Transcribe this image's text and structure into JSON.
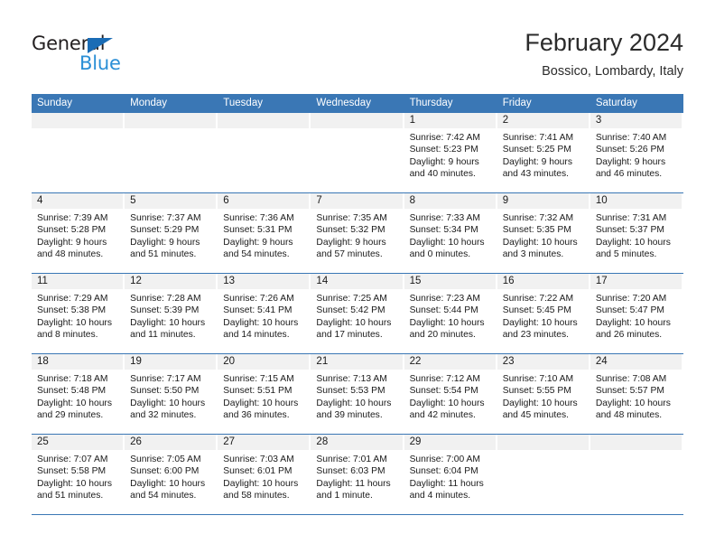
{
  "brand": {
    "name_part1": "General",
    "name_part2": "Blue",
    "accent_color": "#2b8fd6",
    "triangle_color": "#1a6cb5"
  },
  "header": {
    "title": "February 2024",
    "subtitle": "Bossico, Lombardy, Italy"
  },
  "theme": {
    "header_band": "#3a77b5",
    "day_band": "#f1f1f1",
    "text": "#1a1a1a"
  },
  "weekdays": [
    "Sunday",
    "Monday",
    "Tuesday",
    "Wednesday",
    "Thursday",
    "Friday",
    "Saturday"
  ],
  "weeks": [
    [
      {
        "day": "",
        "empty": true
      },
      {
        "day": "",
        "empty": true
      },
      {
        "day": "",
        "empty": true
      },
      {
        "day": "",
        "empty": true
      },
      {
        "day": "1",
        "sunrise": "Sunrise: 7:42 AM",
        "sunset": "Sunset: 5:23 PM",
        "daylight1": "Daylight: 9 hours",
        "daylight2": "and 40 minutes."
      },
      {
        "day": "2",
        "sunrise": "Sunrise: 7:41 AM",
        "sunset": "Sunset: 5:25 PM",
        "daylight1": "Daylight: 9 hours",
        "daylight2": "and 43 minutes."
      },
      {
        "day": "3",
        "sunrise": "Sunrise: 7:40 AM",
        "sunset": "Sunset: 5:26 PM",
        "daylight1": "Daylight: 9 hours",
        "daylight2": "and 46 minutes."
      }
    ],
    [
      {
        "day": "4",
        "sunrise": "Sunrise: 7:39 AM",
        "sunset": "Sunset: 5:28 PM",
        "daylight1": "Daylight: 9 hours",
        "daylight2": "and 48 minutes."
      },
      {
        "day": "5",
        "sunrise": "Sunrise: 7:37 AM",
        "sunset": "Sunset: 5:29 PM",
        "daylight1": "Daylight: 9 hours",
        "daylight2": "and 51 minutes."
      },
      {
        "day": "6",
        "sunrise": "Sunrise: 7:36 AM",
        "sunset": "Sunset: 5:31 PM",
        "daylight1": "Daylight: 9 hours",
        "daylight2": "and 54 minutes."
      },
      {
        "day": "7",
        "sunrise": "Sunrise: 7:35 AM",
        "sunset": "Sunset: 5:32 PM",
        "daylight1": "Daylight: 9 hours",
        "daylight2": "and 57 minutes."
      },
      {
        "day": "8",
        "sunrise": "Sunrise: 7:33 AM",
        "sunset": "Sunset: 5:34 PM",
        "daylight1": "Daylight: 10 hours",
        "daylight2": "and 0 minutes."
      },
      {
        "day": "9",
        "sunrise": "Sunrise: 7:32 AM",
        "sunset": "Sunset: 5:35 PM",
        "daylight1": "Daylight: 10 hours",
        "daylight2": "and 3 minutes."
      },
      {
        "day": "10",
        "sunrise": "Sunrise: 7:31 AM",
        "sunset": "Sunset: 5:37 PM",
        "daylight1": "Daylight: 10 hours",
        "daylight2": "and 5 minutes."
      }
    ],
    [
      {
        "day": "11",
        "sunrise": "Sunrise: 7:29 AM",
        "sunset": "Sunset: 5:38 PM",
        "daylight1": "Daylight: 10 hours",
        "daylight2": "and 8 minutes."
      },
      {
        "day": "12",
        "sunrise": "Sunrise: 7:28 AM",
        "sunset": "Sunset: 5:39 PM",
        "daylight1": "Daylight: 10 hours",
        "daylight2": "and 11 minutes."
      },
      {
        "day": "13",
        "sunrise": "Sunrise: 7:26 AM",
        "sunset": "Sunset: 5:41 PM",
        "daylight1": "Daylight: 10 hours",
        "daylight2": "and 14 minutes."
      },
      {
        "day": "14",
        "sunrise": "Sunrise: 7:25 AM",
        "sunset": "Sunset: 5:42 PM",
        "daylight1": "Daylight: 10 hours",
        "daylight2": "and 17 minutes."
      },
      {
        "day": "15",
        "sunrise": "Sunrise: 7:23 AM",
        "sunset": "Sunset: 5:44 PM",
        "daylight1": "Daylight: 10 hours",
        "daylight2": "and 20 minutes."
      },
      {
        "day": "16",
        "sunrise": "Sunrise: 7:22 AM",
        "sunset": "Sunset: 5:45 PM",
        "daylight1": "Daylight: 10 hours",
        "daylight2": "and 23 minutes."
      },
      {
        "day": "17",
        "sunrise": "Sunrise: 7:20 AM",
        "sunset": "Sunset: 5:47 PM",
        "daylight1": "Daylight: 10 hours",
        "daylight2": "and 26 minutes."
      }
    ],
    [
      {
        "day": "18",
        "sunrise": "Sunrise: 7:18 AM",
        "sunset": "Sunset: 5:48 PM",
        "daylight1": "Daylight: 10 hours",
        "daylight2": "and 29 minutes."
      },
      {
        "day": "19",
        "sunrise": "Sunrise: 7:17 AM",
        "sunset": "Sunset: 5:50 PM",
        "daylight1": "Daylight: 10 hours",
        "daylight2": "and 32 minutes."
      },
      {
        "day": "20",
        "sunrise": "Sunrise: 7:15 AM",
        "sunset": "Sunset: 5:51 PM",
        "daylight1": "Daylight: 10 hours",
        "daylight2": "and 36 minutes."
      },
      {
        "day": "21",
        "sunrise": "Sunrise: 7:13 AM",
        "sunset": "Sunset: 5:53 PM",
        "daylight1": "Daylight: 10 hours",
        "daylight2": "and 39 minutes."
      },
      {
        "day": "22",
        "sunrise": "Sunrise: 7:12 AM",
        "sunset": "Sunset: 5:54 PM",
        "daylight1": "Daylight: 10 hours",
        "daylight2": "and 42 minutes."
      },
      {
        "day": "23",
        "sunrise": "Sunrise: 7:10 AM",
        "sunset": "Sunset: 5:55 PM",
        "daylight1": "Daylight: 10 hours",
        "daylight2": "and 45 minutes."
      },
      {
        "day": "24",
        "sunrise": "Sunrise: 7:08 AM",
        "sunset": "Sunset: 5:57 PM",
        "daylight1": "Daylight: 10 hours",
        "daylight2": "and 48 minutes."
      }
    ],
    [
      {
        "day": "25",
        "sunrise": "Sunrise: 7:07 AM",
        "sunset": "Sunset: 5:58 PM",
        "daylight1": "Daylight: 10 hours",
        "daylight2": "and 51 minutes."
      },
      {
        "day": "26",
        "sunrise": "Sunrise: 7:05 AM",
        "sunset": "Sunset: 6:00 PM",
        "daylight1": "Daylight: 10 hours",
        "daylight2": "and 54 minutes."
      },
      {
        "day": "27",
        "sunrise": "Sunrise: 7:03 AM",
        "sunset": "Sunset: 6:01 PM",
        "daylight1": "Daylight: 10 hours",
        "daylight2": "and 58 minutes."
      },
      {
        "day": "28",
        "sunrise": "Sunrise: 7:01 AM",
        "sunset": "Sunset: 6:03 PM",
        "daylight1": "Daylight: 11 hours",
        "daylight2": "and 1 minute."
      },
      {
        "day": "29",
        "sunrise": "Sunrise: 7:00 AM",
        "sunset": "Sunset: 6:04 PM",
        "daylight1": "Daylight: 11 hours",
        "daylight2": "and 4 minutes."
      },
      {
        "day": "",
        "empty": true
      },
      {
        "day": "",
        "empty": true
      }
    ]
  ]
}
